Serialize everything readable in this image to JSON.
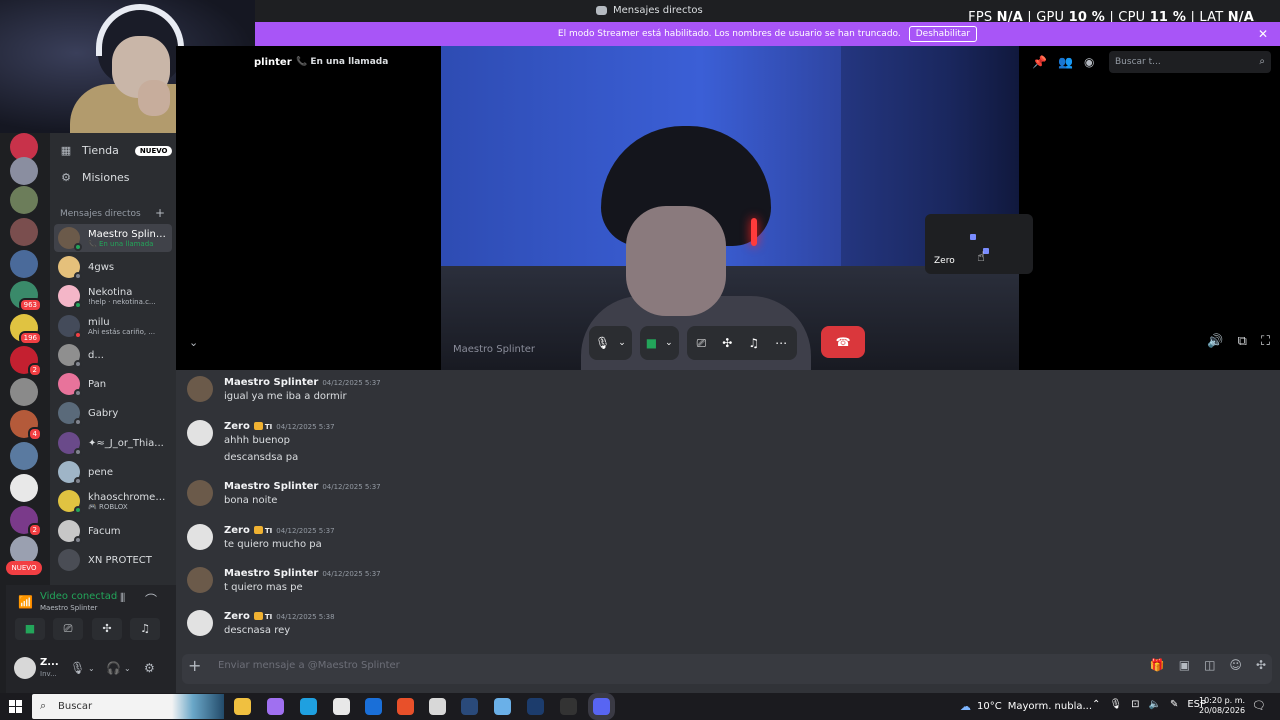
{
  "window": {
    "title": "Mensajes directos"
  },
  "osd": {
    "fps_label": "FPS",
    "fps_value": "N/A",
    "gpu_label": "GPU",
    "gpu_value": "10 %",
    "cpu_label": "CPU",
    "cpu_value": "11 %",
    "lat_label": "LAT",
    "lat_value": "N/A"
  },
  "banner": {
    "text": "El modo Streamer está habilitado. Los nombres de usuario se han truncado.",
    "button": "Deshabilitar",
    "close": "✕"
  },
  "servers": {
    "badges": [
      "963",
      "196",
      "2",
      "4",
      "2"
    ],
    "nuevo": "NUEVO"
  },
  "nav": {
    "store_label": "Tienda",
    "store_badge": "NUEVO",
    "quests_label": "Misiones"
  },
  "dm_header": "Mensajes directos",
  "dms": [
    {
      "name": "Maestro Splinter",
      "sub": "En una llamada",
      "color": "#6b5a4a",
      "status": "#23a55a"
    },
    {
      "name": "4gws",
      "sub": "",
      "color": "#e5c07b",
      "status": "#80848e"
    },
    {
      "name": "Nekotina",
      "sub": "!help · nekotina.c...",
      "color": "#f4b6c8",
      "status": "#23a55a"
    },
    {
      "name": "milu",
      "sub": "Ahi estás cariño, ...",
      "color": "#444b5a",
      "status": "#f23f43"
    },
    {
      "name": "d...",
      "sub": "",
      "color": "#8f8f8f",
      "status": "#80848e"
    },
    {
      "name": "Pan",
      "sub": "",
      "color": "#e8739b",
      "status": "#80848e"
    },
    {
      "name": "Gabry",
      "sub": "",
      "color": "#5a6a7a",
      "status": "#80848e"
    },
    {
      "name": "✦≈_J_or_Thia...",
      "sub": "",
      "color": "#6a4a8a",
      "status": "#80848e"
    },
    {
      "name": "pene",
      "sub": "",
      "color": "#9fb5c7",
      "status": "#80848e"
    },
    {
      "name": "khaoschrome ...",
      "sub": "ROBLOX",
      "color": "#e0c341",
      "status": "#23a55a"
    },
    {
      "name": "Facum",
      "sub": "",
      "color": "#c7c7c7",
      "status": "#80848e"
    },
    {
      "name": "XN PROTECT",
      "sub": "",
      "color": "#4a4d55",
      "status": "#80848e"
    }
  ],
  "voice": {
    "status": "Video conectado",
    "channel": "Maestro Splinter"
  },
  "user": {
    "name": "Z...",
    "status": "Inv..."
  },
  "call": {
    "title": "Maestro Splinter",
    "title_visible": "plinter",
    "in_call": "En una llamada",
    "search_placeholder": "Buscar t...",
    "video_label": "Maestro Splinter",
    "tile_name": "Zero"
  },
  "messages": [
    {
      "author": "Maestro Splinter",
      "tag": "",
      "time": "04/12/2025 5:37",
      "lines": [
        "igual ya me iba a dormir"
      ],
      "avatar": "#6b5a4a"
    },
    {
      "author": "Zero",
      "tag": "TI",
      "time": "04/12/2025 5:37",
      "lines": [
        "ahhh buenop",
        "descansdsa pa"
      ],
      "avatar": "#e2e2e2"
    },
    {
      "author": "Maestro Splinter",
      "tag": "",
      "time": "04/12/2025 5:37",
      "lines": [
        "bona noite"
      ],
      "avatar": "#6b5a4a"
    },
    {
      "author": "Zero",
      "tag": "TI",
      "time": "04/12/2025 5:37",
      "lines": [
        "te quiero mucho pa"
      ],
      "avatar": "#e2e2e2"
    },
    {
      "author": "Maestro Splinter",
      "tag": "",
      "time": "04/12/2025 5:37",
      "lines": [
        "t quiero mas pe"
      ],
      "avatar": "#6b5a4a"
    },
    {
      "author": "Zero",
      "tag": "TI",
      "time": "04/12/2025 5:38",
      "lines": [
        "descnasa rey"
      ],
      "avatar": "#e2e2e2"
    }
  ],
  "composer": {
    "placeholder": "Enviar mensaje a @Maestro Splinter"
  },
  "taskbar": {
    "search": "Buscar",
    "weather": "10°C",
    "weather_desc": "Mayorm. nubla...",
    "lang": "ESP",
    "time": "10:20 p. m.",
    "date": "20/08/2026"
  }
}
